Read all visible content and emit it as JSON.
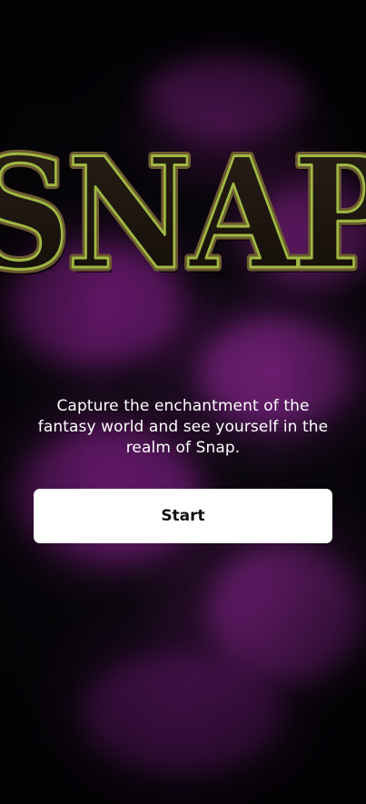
{
  "logo": {
    "text": "SNAP",
    "colors": {
      "fill": "#1a1510",
      "outline_outer": "#7a6a3a",
      "outline_inner": "#a9c24a",
      "shadow": "#000000"
    }
  },
  "tagline": "Capture the enchantment of the fantasy world and see yourself in the realm of Snap.",
  "start_button": {
    "label": "Start"
  },
  "theme": {
    "background": "#07050a",
    "smoke_color": "#9b2aa0",
    "button_bg": "#ffffff",
    "button_text": "#111111",
    "text_color": "#ffffff"
  }
}
